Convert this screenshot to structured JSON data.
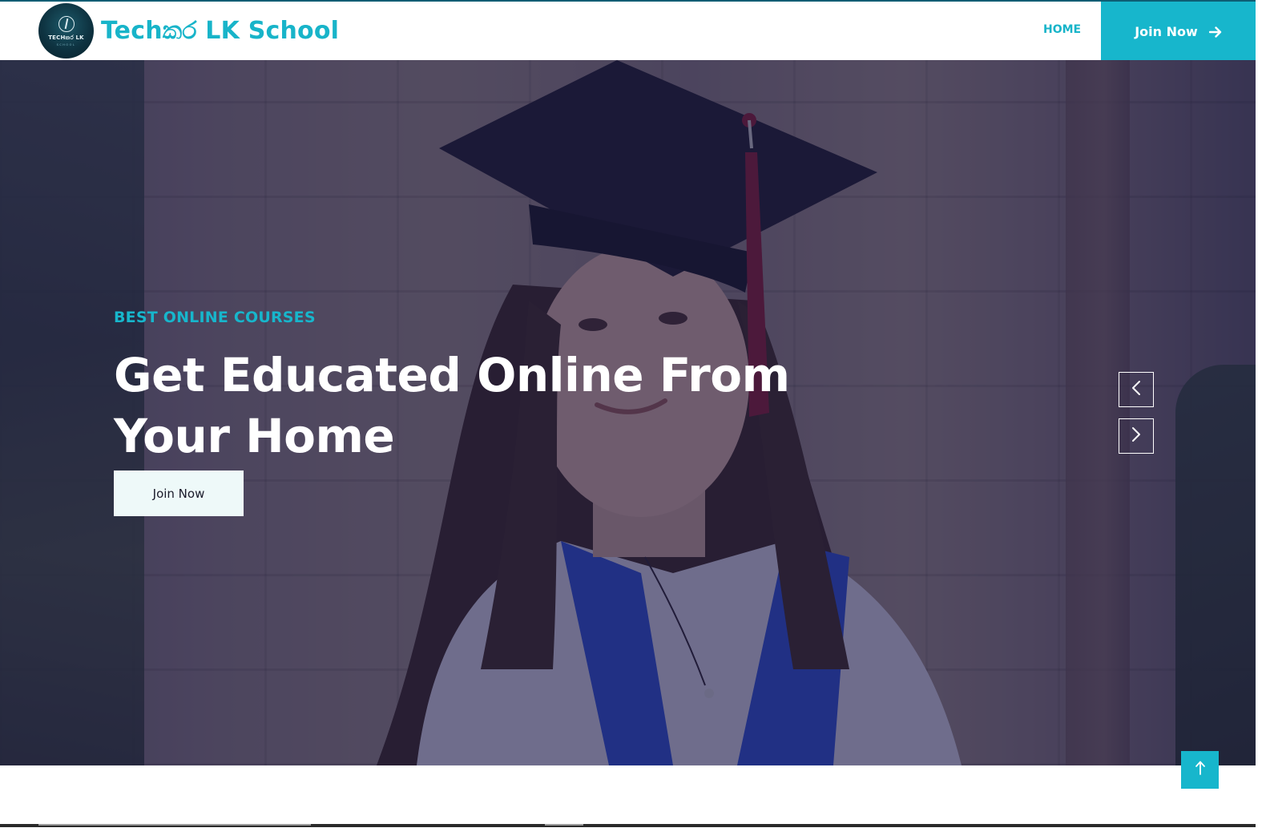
{
  "navbar": {
    "logo": {
      "icon": "compass-pen-icon",
      "text": "TECHකර LK",
      "subtext": "SCHOOL"
    },
    "brand_name": "Techකර LK School",
    "links": [
      {
        "label": "HOME",
        "active": true
      }
    ],
    "join_button": {
      "label": "Join Now",
      "icon": "arrow-right-icon"
    }
  },
  "hero": {
    "kicker": "BEST ONLINE COURSES",
    "title": "Get Educated Online From Your Home",
    "cta_label": "Join Now",
    "carousel": {
      "prev_icon": "chevron-left-icon",
      "next_icon": "chevron-right-icon"
    }
  },
  "back_to_top": {
    "icon": "arrow-up-icon"
  },
  "colors": {
    "accent": "#17b6cc",
    "overlay": "#191842",
    "button_light": "#eef9f9",
    "navbar_bg": "#ffffff"
  }
}
